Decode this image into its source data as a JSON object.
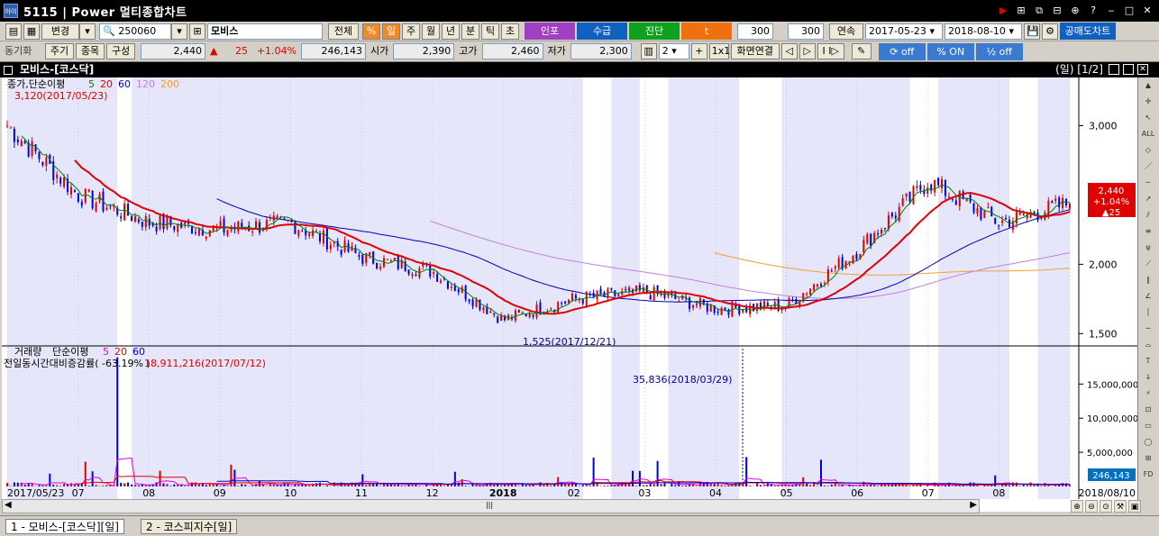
{
  "window": {
    "app_icon": "아이",
    "title": "5115 | Power 멀티종합차트",
    "title_buttons": [
      "▶",
      "⊞",
      "⧉",
      "⊟",
      "⊕",
      "?",
      "‒",
      "□",
      "✕"
    ]
  },
  "toolbar1": {
    "change_label": "변경",
    "code": "250060",
    "stock_name": "모비스",
    "all_label": "전체",
    "pct_label": "%",
    "periods": [
      "일",
      "주",
      "월",
      "년",
      "분",
      "틱",
      "초"
    ],
    "active_period": "일",
    "inpo_label": "인포",
    "supply_label": "수급",
    "diag_label": "진단",
    "t_label": "t",
    "count1": "300",
    "count2": "300",
    "cont_label": "연속",
    "date_from": "2017-05-23",
    "date_to": "2018-08-10",
    "short_label": "공매도차트"
  },
  "toolbar2": {
    "sync_label": "동기화",
    "cycle_label": "주기",
    "item_label": "종목",
    "config_label": "구성",
    "price": "2,440",
    "change": "25",
    "change_pct": "+1.04%",
    "volume": "246,143",
    "open_label": "시가",
    "open": "2,390",
    "high_label": "고가",
    "high": "2,460",
    "low_label": "저가",
    "low": "2,300",
    "split_count": "2",
    "one_label": "1x1",
    "link_label": "화면연결",
    "off1": "off",
    "on_label": "ON",
    "off2": "off"
  },
  "chart_header": {
    "name": "모비스-[코스닥]",
    "page": "(일) [1/2]"
  },
  "price_panel": {
    "legend_label": "종가,단순이평",
    "ma_periods": [
      "5",
      "20",
      "60",
      "120",
      "200"
    ],
    "ma_colors": [
      "#008000",
      "#e00000",
      "#0000c0",
      "#c080e0",
      "#f0a030"
    ],
    "high_note": "3,120(2017/05/23)",
    "low_note": "1,525(2017/12/21)",
    "current_box": [
      "2,440",
      "+1.04%",
      "▲25"
    ],
    "y_ticks": [
      "3,000",
      "2,000",
      "1,500"
    ]
  },
  "volume_panel": {
    "legend_label": "거래량",
    "legend_ma": "단순이평",
    "ma_periods": [
      "5",
      "20",
      "60"
    ],
    "ratio_label": "전일동시간대비증감률( -63.19% )",
    "max_note": "18,911,216(2017/07/12)",
    "note2": "35,836(2018/03/29)",
    "current_box": "246,143",
    "y_ticks": [
      "15,000,000",
      "10,000,000",
      "5,000,000"
    ]
  },
  "x_axis": [
    "2017/05/23",
    "07",
    "08",
    "09",
    "10",
    "11",
    "12",
    "2018",
    "02",
    "03",
    "04",
    "05",
    "06",
    "07",
    "08",
    "2018/08/10"
  ],
  "tabs": [
    "1 - 모비스-[코스닥][일]",
    "2 - 코스피지수[일]"
  ],
  "chart_data": {
    "type": "candlestick",
    "title": "모비스-[코스닥]",
    "period": "일",
    "x_range": [
      "2017/05/23",
      "2018/08/10"
    ],
    "ylim": [
      1450,
      3250
    ],
    "current": {
      "close": 2440,
      "change": 25,
      "change_pct": 1.04,
      "open": 2390,
      "high": 2460,
      "low": 2300,
      "volume": 246143
    },
    "high_point": {
      "value": 3120,
      "date": "2017/05/23"
    },
    "low_point": {
      "value": 1525,
      "date": "2017/12/21"
    },
    "approx_close_by_month": [
      {
        "x": "2017/05/23",
        "y": 3000
      },
      {
        "x": "2017/06",
        "y": 2500
      },
      {
        "x": "2017/07",
        "y": 2300
      },
      {
        "x": "2017/08",
        "y": 2250
      },
      {
        "x": "2017/09",
        "y": 2300
      },
      {
        "x": "2017/10",
        "y": 2050
      },
      {
        "x": "2017/11",
        "y": 1950
      },
      {
        "x": "2017/12",
        "y": 1600
      },
      {
        "x": "2018/01",
        "y": 1750
      },
      {
        "x": "2018/02",
        "y": 1800
      },
      {
        "x": "2018/03",
        "y": 1680
      },
      {
        "x": "2018/04",
        "y": 1700
      },
      {
        "x": "2018/05",
        "y": 2100
      },
      {
        "x": "2018/06",
        "y": 2600
      },
      {
        "x": "2018/07",
        "y": 2300
      },
      {
        "x": "2018/08/10",
        "y": 2440
      }
    ],
    "volume_ylim": [
      0,
      19000000
    ],
    "volume_peak": {
      "value": 18911216,
      "date": "2017/07/12"
    }
  }
}
